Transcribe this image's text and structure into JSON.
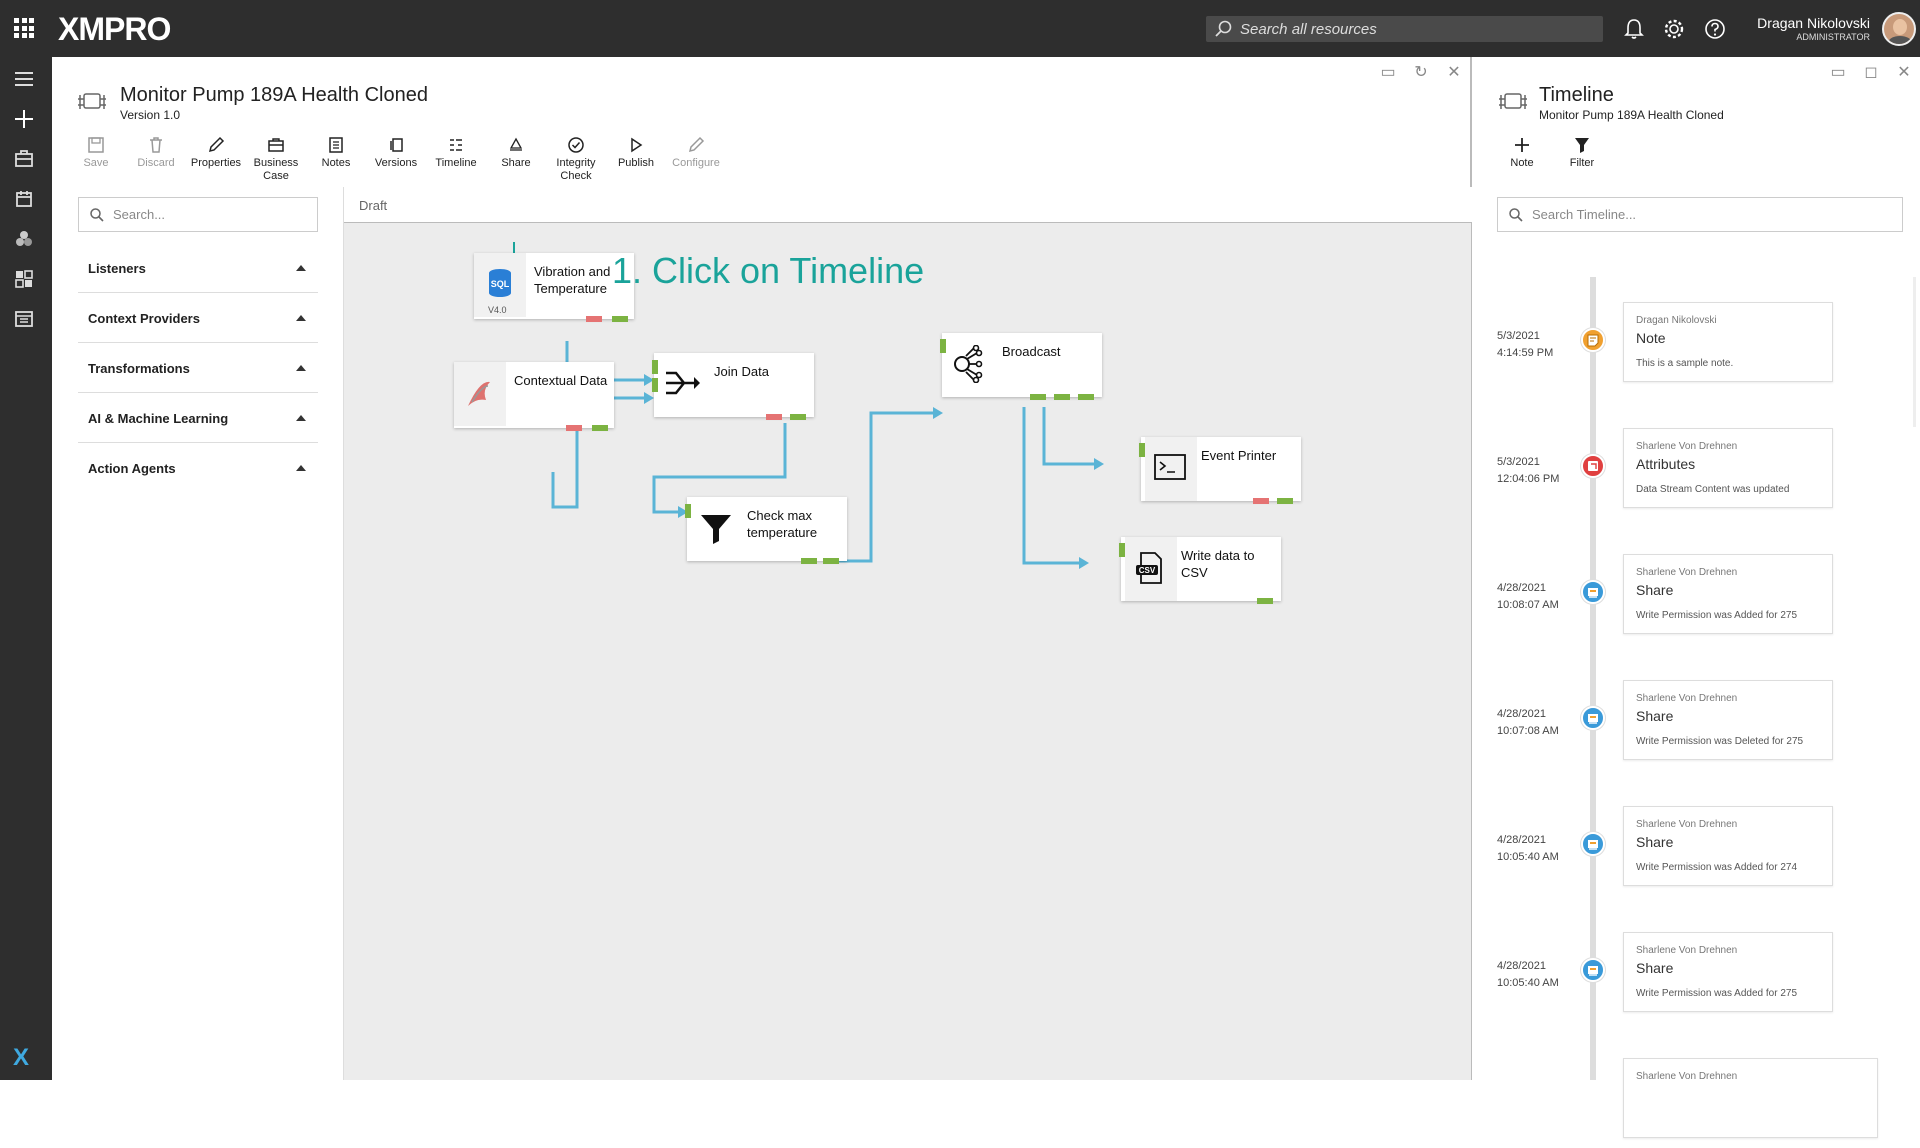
{
  "app": {
    "logo": "XMPRO"
  },
  "topbar": {
    "search_placeholder": "Search all resources",
    "user_name": "Dragan Nikolovski",
    "user_role": "ADMINISTRATOR"
  },
  "main": {
    "title": "Monitor Pump 189A Health Cloned",
    "version": "Version 1.0",
    "toolbar": [
      {
        "label": "Save",
        "icon": "save-icon",
        "enabled": false
      },
      {
        "label": "Discard",
        "icon": "trash-icon",
        "enabled": false
      },
      {
        "label": "Properties",
        "icon": "pencil-icon",
        "enabled": true
      },
      {
        "label": "Business Case",
        "icon": "briefcase-icon",
        "enabled": true
      },
      {
        "label": "Notes",
        "icon": "notes-icon",
        "enabled": true
      },
      {
        "label": "Versions",
        "icon": "versions-icon",
        "enabled": true
      },
      {
        "label": "Timeline",
        "icon": "timeline-icon",
        "enabled": true
      },
      {
        "label": "Share",
        "icon": "share-icon",
        "enabled": true
      },
      {
        "label": "Integrity Check",
        "icon": "check-circle-icon",
        "enabled": true
      },
      {
        "label": "Publish",
        "icon": "play-icon",
        "enabled": true
      },
      {
        "label": "Configure",
        "icon": "pencil-icon",
        "enabled": false
      }
    ],
    "sidebar": {
      "search_placeholder": "Search...",
      "categories": [
        "Listeners",
        "Context Providers",
        "Transformations",
        "AI & Machine Learning",
        "Action Agents"
      ]
    },
    "canvas": {
      "status": "Draft",
      "annotation": "1. Click on Timeline",
      "nodes": [
        {
          "id": "vibration",
          "label_line1": "Vibration and",
          "label_line2": "Temperature",
          "version": "V4.0",
          "icon": "sql-icon"
        },
        {
          "id": "contextual",
          "label_line1": "Contextual Data",
          "label_line2": "",
          "icon": "sql-server-icon"
        },
        {
          "id": "join",
          "label_line1": "Join Data",
          "label_line2": "",
          "icon": "join-icon"
        },
        {
          "id": "check",
          "label_line1": "Check max",
          "label_line2": "temperature",
          "icon": "filter-icon"
        },
        {
          "id": "broadcast",
          "label_line1": "Broadcast",
          "label_line2": "",
          "icon": "broadcast-icon"
        },
        {
          "id": "printer",
          "label_line1": "Event Printer",
          "label_line2": "",
          "icon": "terminal-icon"
        },
        {
          "id": "csv",
          "label_line1": "Write data to CSV",
          "label_line2": "",
          "icon": "csv-file-icon"
        }
      ]
    }
  },
  "timeline": {
    "title": "Timeline",
    "subtitle": "Monitor Pump 189A Health Cloned",
    "toolbar": [
      {
        "label": "Note",
        "icon": "plus-icon"
      },
      {
        "label": "Filter",
        "icon": "filter-icon"
      }
    ],
    "search_placeholder": "Search Timeline...",
    "entries": [
      {
        "date": "5/3/2021",
        "time": "4:14:59 PM",
        "user": "Dragan Nikolovski",
        "action": "Note",
        "description": "This is a sample note.",
        "color": "#f0a030",
        "icon": "note-icon"
      },
      {
        "date": "5/3/2021",
        "time": "12:04:06 PM",
        "user": "Sharlene Von Drehnen",
        "action": "Attributes",
        "description": "Data Stream Content was updated",
        "color": "#e04040",
        "icon": "attributes-icon"
      },
      {
        "date": "4/28/2021",
        "time": "10:08:07 AM",
        "user": "Sharlene Von Drehnen",
        "action": "Share",
        "description": "Write Permission was Added for 275",
        "color": "#3a9ad9",
        "icon": "share-icon"
      },
      {
        "date": "4/28/2021",
        "time": "10:07:08 AM",
        "user": "Sharlene Von Drehnen",
        "action": "Share",
        "description": "Write Permission was Deleted for 275",
        "color": "#3a9ad9",
        "icon": "share-icon"
      },
      {
        "date": "4/28/2021",
        "time": "10:05:40 AM",
        "user": "Sharlene Von Drehnen",
        "action": "Share",
        "description": "Write Permission was Added for 274",
        "color": "#3a9ad9",
        "icon": "share-icon"
      },
      {
        "date": "4/28/2021",
        "time": "10:05:40 AM",
        "user": "Sharlene Von Drehnen",
        "action": "Share",
        "description": "Write Permission was Added for 275",
        "color": "#3a9ad9",
        "icon": "share-icon"
      }
    ],
    "partial_entry_user": "Sharlene Von Drehnen"
  }
}
